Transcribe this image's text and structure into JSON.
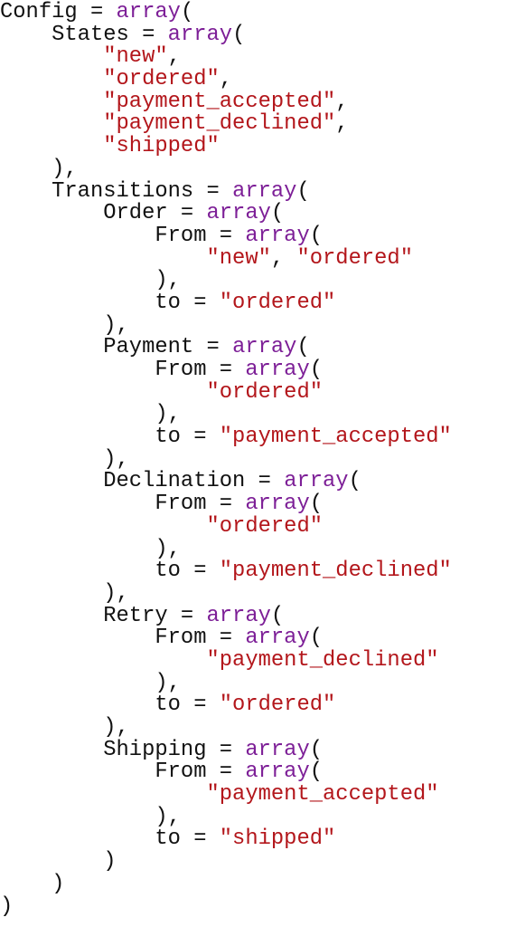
{
  "document": {
    "language": "php-like config",
    "colors": {
      "identifier": "#111111",
      "keyword": "#7d1f97",
      "string": "#b3161b"
    },
    "lines": [
      {
        "indent": 0,
        "tokens": [
          {
            "t": "id",
            "v": "Config"
          },
          {
            "t": "punc",
            "v": " = "
          },
          {
            "t": "kw",
            "v": "array"
          },
          {
            "t": "punc",
            "v": "("
          }
        ]
      },
      {
        "indent": 1,
        "tokens": [
          {
            "t": "id",
            "v": "States"
          },
          {
            "t": "punc",
            "v": " = "
          },
          {
            "t": "kw",
            "v": "array"
          },
          {
            "t": "punc",
            "v": "("
          }
        ]
      },
      {
        "indent": 2,
        "tokens": [
          {
            "t": "str",
            "v": "\"new\""
          },
          {
            "t": "punc",
            "v": ","
          }
        ]
      },
      {
        "indent": 2,
        "tokens": [
          {
            "t": "str",
            "v": "\"ordered\""
          },
          {
            "t": "punc",
            "v": ","
          }
        ]
      },
      {
        "indent": 2,
        "tokens": [
          {
            "t": "str",
            "v": "\"payment_accepted\""
          },
          {
            "t": "punc",
            "v": ","
          }
        ]
      },
      {
        "indent": 2,
        "tokens": [
          {
            "t": "str",
            "v": "\"payment_declined\""
          },
          {
            "t": "punc",
            "v": ","
          }
        ]
      },
      {
        "indent": 2,
        "tokens": [
          {
            "t": "str",
            "v": "\"shipped\""
          }
        ]
      },
      {
        "indent": 1,
        "tokens": [
          {
            "t": "punc",
            "v": "),"
          }
        ]
      },
      {
        "indent": 1,
        "tokens": [
          {
            "t": "id",
            "v": "Transitions"
          },
          {
            "t": "punc",
            "v": " = "
          },
          {
            "t": "kw",
            "v": "array"
          },
          {
            "t": "punc",
            "v": "("
          }
        ]
      },
      {
        "indent": 2,
        "tokens": [
          {
            "t": "id",
            "v": "Order"
          },
          {
            "t": "punc",
            "v": " = "
          },
          {
            "t": "kw",
            "v": "array"
          },
          {
            "t": "punc",
            "v": "("
          }
        ]
      },
      {
        "indent": 3,
        "tokens": [
          {
            "t": "id",
            "v": "From"
          },
          {
            "t": "punc",
            "v": " = "
          },
          {
            "t": "kw",
            "v": "array"
          },
          {
            "t": "punc",
            "v": "("
          }
        ]
      },
      {
        "indent": 4,
        "tokens": [
          {
            "t": "str",
            "v": "\"new\""
          },
          {
            "t": "punc",
            "v": ", "
          },
          {
            "t": "str",
            "v": "\"ordered\""
          }
        ]
      },
      {
        "indent": 3,
        "tokens": [
          {
            "t": "punc",
            "v": "),"
          }
        ]
      },
      {
        "indent": 3,
        "tokens": [
          {
            "t": "id",
            "v": "to"
          },
          {
            "t": "punc",
            "v": " = "
          },
          {
            "t": "str",
            "v": "\"ordered\""
          }
        ]
      },
      {
        "indent": 2,
        "tokens": [
          {
            "t": "punc",
            "v": "),"
          }
        ]
      },
      {
        "indent": 2,
        "tokens": [
          {
            "t": "id",
            "v": "Payment"
          },
          {
            "t": "punc",
            "v": " = "
          },
          {
            "t": "kw",
            "v": "array"
          },
          {
            "t": "punc",
            "v": "("
          }
        ]
      },
      {
        "indent": 3,
        "tokens": [
          {
            "t": "id",
            "v": "From"
          },
          {
            "t": "punc",
            "v": " = "
          },
          {
            "t": "kw",
            "v": "array"
          },
          {
            "t": "punc",
            "v": "("
          }
        ]
      },
      {
        "indent": 4,
        "tokens": [
          {
            "t": "str",
            "v": "\"ordered\""
          }
        ]
      },
      {
        "indent": 3,
        "tokens": [
          {
            "t": "punc",
            "v": "),"
          }
        ]
      },
      {
        "indent": 3,
        "tokens": [
          {
            "t": "id",
            "v": "to"
          },
          {
            "t": "punc",
            "v": " = "
          },
          {
            "t": "str",
            "v": "\"payment_accepted\""
          }
        ]
      },
      {
        "indent": 2,
        "tokens": [
          {
            "t": "punc",
            "v": "),"
          }
        ]
      },
      {
        "indent": 2,
        "tokens": [
          {
            "t": "id",
            "v": "Declination"
          },
          {
            "t": "punc",
            "v": " = "
          },
          {
            "t": "kw",
            "v": "array"
          },
          {
            "t": "punc",
            "v": "("
          }
        ]
      },
      {
        "indent": 3,
        "tokens": [
          {
            "t": "id",
            "v": "From"
          },
          {
            "t": "punc",
            "v": " = "
          },
          {
            "t": "kw",
            "v": "array"
          },
          {
            "t": "punc",
            "v": "("
          }
        ]
      },
      {
        "indent": 4,
        "tokens": [
          {
            "t": "str",
            "v": "\"ordered\""
          }
        ]
      },
      {
        "indent": 3,
        "tokens": [
          {
            "t": "punc",
            "v": "),"
          }
        ]
      },
      {
        "indent": 3,
        "tokens": [
          {
            "t": "id",
            "v": "to"
          },
          {
            "t": "punc",
            "v": " = "
          },
          {
            "t": "str",
            "v": "\"payment_declined\""
          }
        ]
      },
      {
        "indent": 2,
        "tokens": [
          {
            "t": "punc",
            "v": "),"
          }
        ]
      },
      {
        "indent": 2,
        "tokens": [
          {
            "t": "id",
            "v": "Retry"
          },
          {
            "t": "punc",
            "v": " = "
          },
          {
            "t": "kw",
            "v": "array"
          },
          {
            "t": "punc",
            "v": "("
          }
        ]
      },
      {
        "indent": 3,
        "tokens": [
          {
            "t": "id",
            "v": "From"
          },
          {
            "t": "punc",
            "v": " = "
          },
          {
            "t": "kw",
            "v": "array"
          },
          {
            "t": "punc",
            "v": "("
          }
        ]
      },
      {
        "indent": 4,
        "tokens": [
          {
            "t": "str",
            "v": "\"payment_declined\""
          }
        ]
      },
      {
        "indent": 3,
        "tokens": [
          {
            "t": "punc",
            "v": "),"
          }
        ]
      },
      {
        "indent": 3,
        "tokens": [
          {
            "t": "id",
            "v": "to"
          },
          {
            "t": "punc",
            "v": " = "
          },
          {
            "t": "str",
            "v": "\"ordered\""
          }
        ]
      },
      {
        "indent": 2,
        "tokens": [
          {
            "t": "punc",
            "v": "),"
          }
        ]
      },
      {
        "indent": 2,
        "tokens": [
          {
            "t": "id",
            "v": "Shipping"
          },
          {
            "t": "punc",
            "v": " = "
          },
          {
            "t": "kw",
            "v": "array"
          },
          {
            "t": "punc",
            "v": "("
          }
        ]
      },
      {
        "indent": 3,
        "tokens": [
          {
            "t": "id",
            "v": "From"
          },
          {
            "t": "punc",
            "v": " = "
          },
          {
            "t": "kw",
            "v": "array"
          },
          {
            "t": "punc",
            "v": "("
          }
        ]
      },
      {
        "indent": 4,
        "tokens": [
          {
            "t": "str",
            "v": "\"payment_accepted\""
          }
        ]
      },
      {
        "indent": 3,
        "tokens": [
          {
            "t": "punc",
            "v": "),"
          }
        ]
      },
      {
        "indent": 3,
        "tokens": [
          {
            "t": "id",
            "v": "to"
          },
          {
            "t": "punc",
            "v": " = "
          },
          {
            "t": "str",
            "v": "\"shipped\""
          }
        ]
      },
      {
        "indent": 2,
        "tokens": [
          {
            "t": "punc",
            "v": ")"
          }
        ]
      },
      {
        "indent": 1,
        "tokens": [
          {
            "t": "punc",
            "v": ")"
          }
        ]
      },
      {
        "indent": 0,
        "tokens": [
          {
            "t": "punc",
            "v": ")"
          }
        ]
      }
    ]
  }
}
